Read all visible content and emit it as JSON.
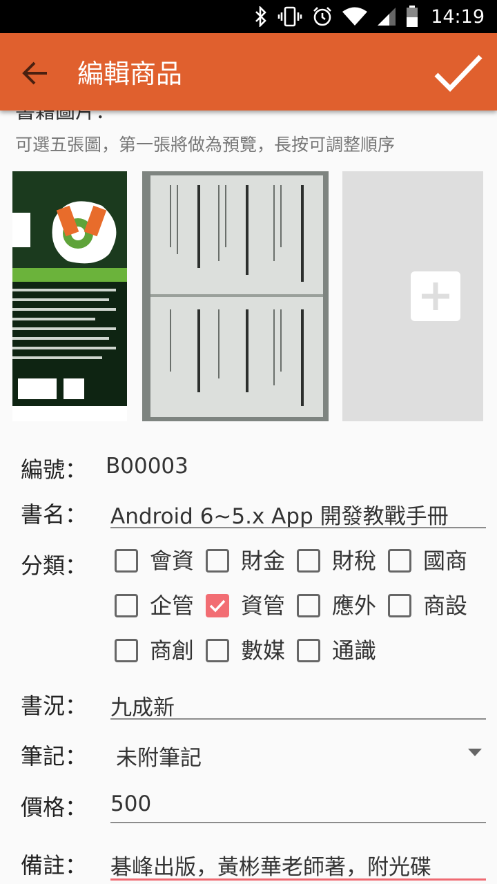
{
  "status_bar": {
    "time": "14:19"
  },
  "app_bar": {
    "title": "編輯商品"
  },
  "images_section": {
    "heading": "書籍圖片：",
    "hint": "可選五張圖，第一張將做為預覽，長按可調整順序"
  },
  "form": {
    "id_label": "編號：",
    "id_value": "B00003",
    "name_label": "書名：",
    "name_value": "Android 6~5.x App 開發教戰手冊",
    "category_label": "分類：",
    "categories": [
      {
        "label": "會資",
        "checked": false
      },
      {
        "label": "財金",
        "checked": false
      },
      {
        "label": "財稅",
        "checked": false
      },
      {
        "label": "國商",
        "checked": false
      },
      {
        "label": "企管",
        "checked": false
      },
      {
        "label": "資管",
        "checked": true
      },
      {
        "label": "應外",
        "checked": false
      },
      {
        "label": "商設",
        "checked": false
      },
      {
        "label": "商創",
        "checked": false
      },
      {
        "label": "數媒",
        "checked": false
      },
      {
        "label": "通識",
        "checked": false
      }
    ],
    "condition_label": "書況：",
    "condition_value": "九成新",
    "notes_label": "筆記：",
    "notes_value": "未附筆記",
    "price_label": "價格：",
    "price_value": "500",
    "remark_label": "備註：",
    "remark_value": "碁峰出版，黃彬華老師著，附光碟"
  },
  "colors": {
    "accent": "#e0602e",
    "checkbox_checked": "#f26d73"
  }
}
